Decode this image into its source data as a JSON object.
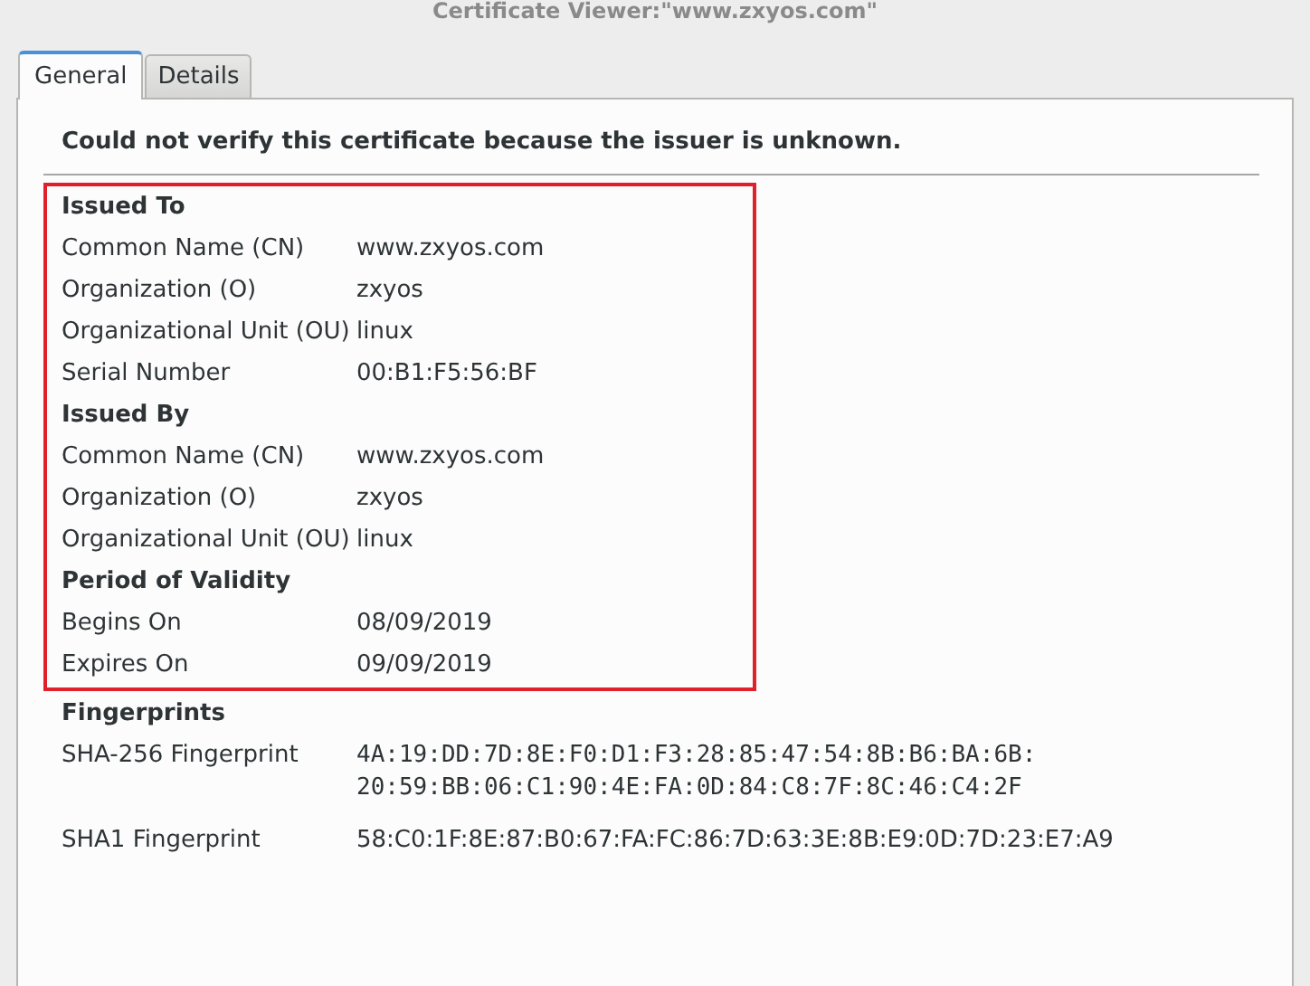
{
  "window": {
    "title": "Certificate Viewer:\"www.zxyos.com\""
  },
  "tabs": [
    {
      "label": "General",
      "selected": true
    },
    {
      "label": "Details",
      "selected": false
    }
  ],
  "message": "Could not verify this certificate because the issuer is unknown.",
  "sections": [
    {
      "heading": "Issued To",
      "annotated": true,
      "rows": [
        {
          "label": "Common Name (CN)",
          "value": [
            "www.zxyos.com"
          ]
        },
        {
          "label": "Organization (O)",
          "value": [
            "zxyos"
          ]
        },
        {
          "label": "Organizational Unit (OU)",
          "value": [
            "linux"
          ]
        },
        {
          "label": "Serial Number",
          "value": [
            "00:B1:F5:56:BF"
          ]
        }
      ]
    },
    {
      "heading": "Issued By",
      "annotated": true,
      "rows": [
        {
          "label": "Common Name (CN)",
          "value": [
            "www.zxyos.com"
          ]
        },
        {
          "label": "Organization (O)",
          "value": [
            "zxyos"
          ]
        },
        {
          "label": "Organizational Unit (OU)",
          "value": [
            "linux"
          ]
        }
      ]
    },
    {
      "heading": "Period of Validity",
      "annotated": true,
      "rows": [
        {
          "label": "Begins On",
          "value": [
            "08/09/2019"
          ]
        },
        {
          "label": "Expires On",
          "value": [
            "09/09/2019"
          ]
        }
      ]
    },
    {
      "heading": "Fingerprints",
      "annotated": false,
      "rows": [
        {
          "label": "SHA-256 Fingerprint",
          "kind": "mono",
          "value": [
            "4A:19:DD:7D:8E:F0:D1:F3:28:85:47:54:8B:B6:BA:6B:",
            "20:59:BB:06:C1:90:4E:FA:0D:84:C8:7F:8C:46:C4:2F"
          ]
        },
        {
          "label": "SHA1 Fingerprint",
          "kind": "plain",
          "value": [
            "58:C0:1F:8E:87:B0:67:FA:FC:86:7D:63:3E:8B:E9:0D:7D:23:E7:A9"
          ]
        }
      ]
    }
  ]
}
